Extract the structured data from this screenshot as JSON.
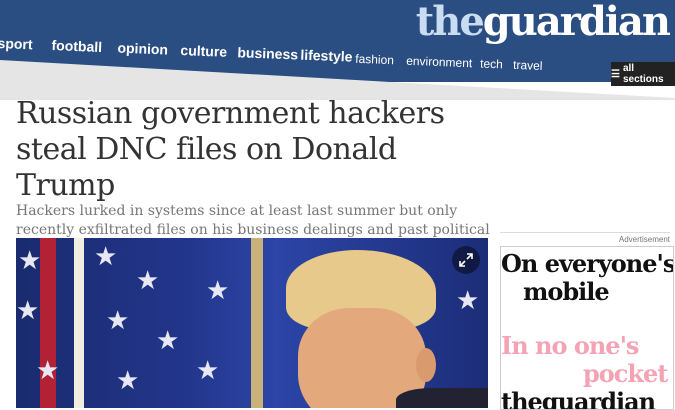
{
  "header": {
    "logo_the": "the",
    "logo_guardian": "guardian",
    "nav": [
      "sport",
      "football",
      "opinion",
      "culture",
      "business",
      "lifestyle",
      "fashion",
      "environment",
      "tech",
      "travel"
    ],
    "all_sections": "all sections"
  },
  "article": {
    "headline": "Russian government hackers steal DNC files on Donald Trump",
    "standfirst": "Hackers lurked in systems since at least last summer but only recently exfiltrated files on his business dealings and past political statements, investigators said"
  },
  "ad": {
    "label": "Advertisement",
    "line1": "On everyone's",
    "line2": "mobile",
    "line3": "In no one's",
    "line4": "pocket",
    "line5": "theguardian"
  },
  "colors": {
    "brand_blue": "#2a4d82",
    "ad_pink": "#f4a3b4"
  }
}
